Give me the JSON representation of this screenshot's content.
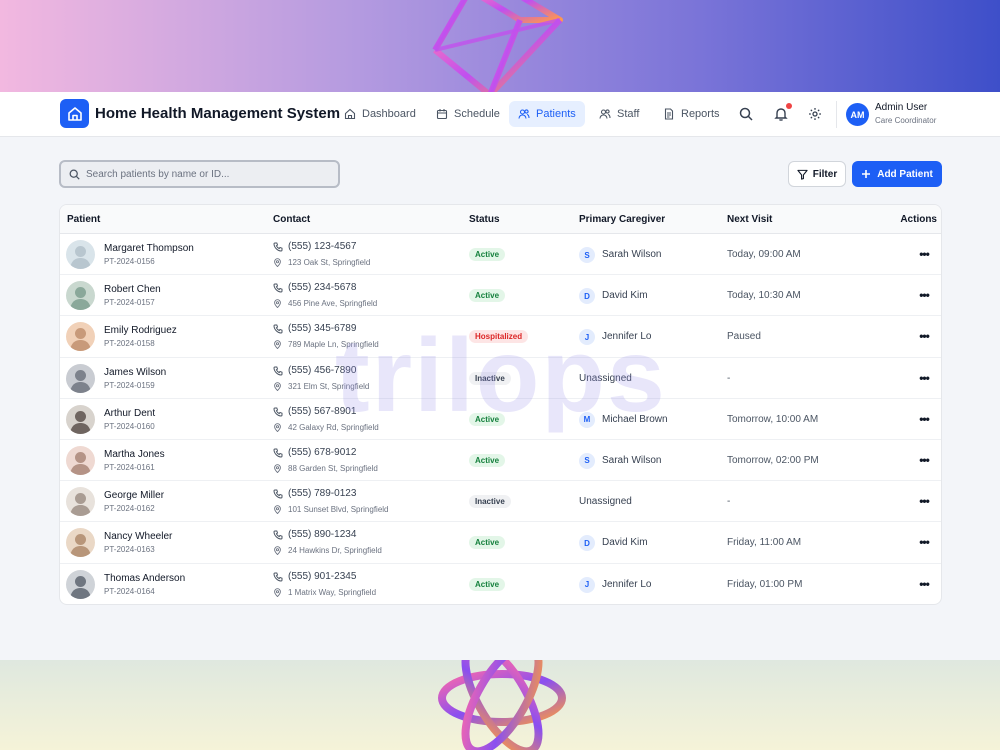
{
  "app": {
    "title": "Home Health Management System"
  },
  "nav": [
    {
      "label": "Dashboard",
      "icon": "home-icon",
      "active": false
    },
    {
      "label": "Schedule",
      "icon": "calendar-icon",
      "active": false
    },
    {
      "label": "Patients",
      "icon": "users-icon",
      "active": true
    },
    {
      "label": "Staff",
      "icon": "user-plus-icon",
      "active": false
    },
    {
      "label": "Reports",
      "icon": "document-icon",
      "active": false
    }
  ],
  "user": {
    "initials": "AM",
    "name": "Admin User",
    "role": "Care Coordinator"
  },
  "search": {
    "placeholder": "Search patients by name or ID..."
  },
  "toolbar": {
    "filter_label": "Filter",
    "add_label": "Add Patient"
  },
  "table": {
    "headers": {
      "patient": "Patient",
      "contact": "Contact",
      "status": "Status",
      "caregiver": "Primary Caregiver",
      "next_visit": "Next Visit",
      "actions": "Actions"
    },
    "rows": [
      {
        "name": "Margaret Thompson",
        "id": "PT-2024-0156",
        "phone": "(555) 123-4567",
        "address": "123 Oak St, Springfield",
        "status": "Active",
        "status_kind": "active",
        "caregiver_initial": "S",
        "caregiver": "Sarah Wilson",
        "next_visit": "Today, 09:00 AM"
      },
      {
        "name": "Robert Chen",
        "id": "PT-2024-0157",
        "phone": "(555) 234-5678",
        "address": "456 Pine Ave, Springfield",
        "status": "Active",
        "status_kind": "active",
        "caregiver_initial": "D",
        "caregiver": "David Kim",
        "next_visit": "Today, 10:30 AM"
      },
      {
        "name": "Emily Rodriguez",
        "id": "PT-2024-0158",
        "phone": "(555) 345-6789",
        "address": "789 Maple Ln, Springfield",
        "status": "Hospitalized",
        "status_kind": "hospitalized",
        "caregiver_initial": "J",
        "caregiver": "Jennifer Lo",
        "next_visit": "Paused"
      },
      {
        "name": "James Wilson",
        "id": "PT-2024-0159",
        "phone": "(555) 456-7890",
        "address": "321 Elm St, Springfield",
        "status": "Inactive",
        "status_kind": "inactive",
        "caregiver_initial": "",
        "caregiver": "Unassigned",
        "next_visit": "-"
      },
      {
        "name": "Arthur Dent",
        "id": "PT-2024-0160",
        "phone": "(555) 567-8901",
        "address": "42 Galaxy Rd, Springfield",
        "status": "Active",
        "status_kind": "active",
        "caregiver_initial": "M",
        "caregiver": "Michael Brown",
        "next_visit": "Tomorrow, 10:00 AM"
      },
      {
        "name": "Martha Jones",
        "id": "PT-2024-0161",
        "phone": "(555) 678-9012",
        "address": "88 Garden St, Springfield",
        "status": "Active",
        "status_kind": "active",
        "caregiver_initial": "S",
        "caregiver": "Sarah Wilson",
        "next_visit": "Tomorrow, 02:00 PM"
      },
      {
        "name": "George Miller",
        "id": "PT-2024-0162",
        "phone": "(555) 789-0123",
        "address": "101 Sunset Blvd, Springfield",
        "status": "Inactive",
        "status_kind": "inactive",
        "caregiver_initial": "",
        "caregiver": "Unassigned",
        "next_visit": "-"
      },
      {
        "name": "Nancy Wheeler",
        "id": "PT-2024-0163",
        "phone": "(555) 890-1234",
        "address": "24 Hawkins Dr, Springfield",
        "status": "Active",
        "status_kind": "active",
        "caregiver_initial": "D",
        "caregiver": "David Kim",
        "next_visit": "Friday, 11:00 AM"
      },
      {
        "name": "Thomas Anderson",
        "id": "PT-2024-0164",
        "phone": "(555) 901-2345",
        "address": "1 Matrix Way, Springfield",
        "status": "Active",
        "status_kind": "active",
        "caregiver_initial": "J",
        "caregiver": "Jennifer Lo",
        "next_visit": "Friday, 01:00 PM"
      }
    ]
  },
  "colors": {
    "primary": "#1d5ff5",
    "active_badge": "#15803d",
    "hospitalized_badge": "#dc2626",
    "notification_dot": "#ef4444"
  },
  "watermark": "trilops"
}
